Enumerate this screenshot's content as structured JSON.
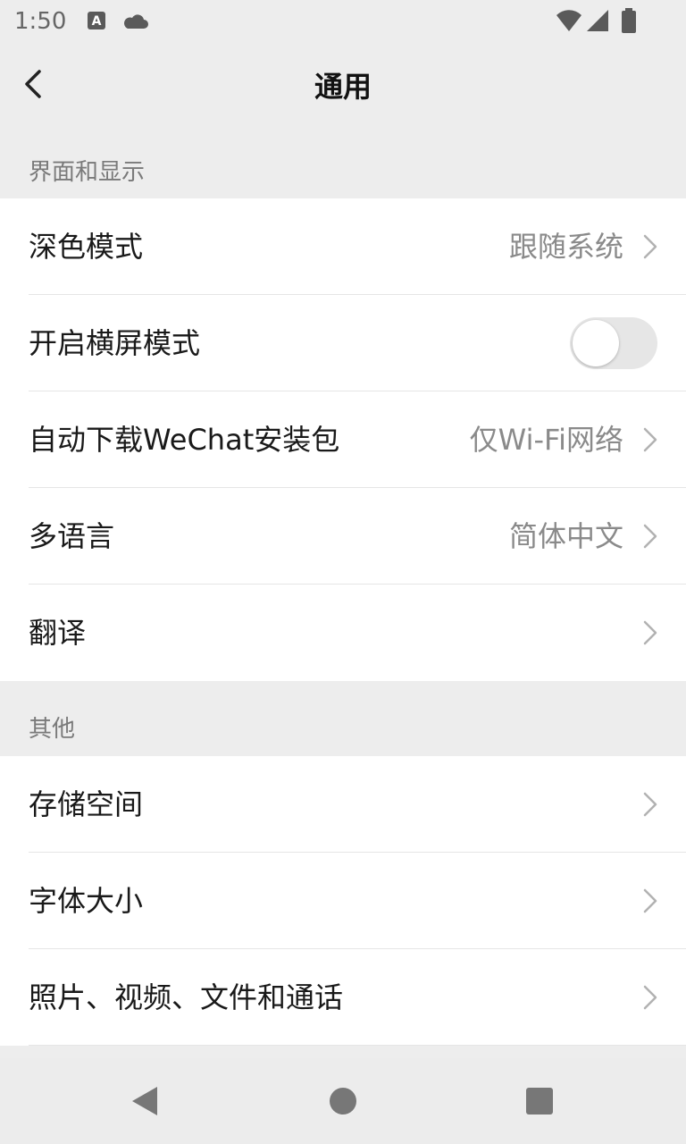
{
  "status_bar": {
    "time": "1:50",
    "icons": [
      "a-notification-icon",
      "cloud-icon",
      "wifi-icon",
      "signal-icon",
      "battery-icon"
    ]
  },
  "header": {
    "title": "通用",
    "back_icon": "back-chevron-icon"
  },
  "sections": [
    {
      "title": "界面和显示",
      "items": [
        {
          "label": "深色模式",
          "value": "跟随系统"
        },
        {
          "label": "开启横屏模式",
          "toggle": false
        },
        {
          "label": "自动下载WeChat安装包",
          "value": "仅Wi-Fi网络"
        },
        {
          "label": "多语言",
          "value": "简体中文"
        },
        {
          "label": "翻译",
          "value": ""
        }
      ]
    },
    {
      "title": "其他",
      "items": [
        {
          "label": "存储空间"
        },
        {
          "label": "字体大小"
        },
        {
          "label": "照片、视频、文件和通话"
        }
      ]
    }
  ],
  "system_nav": [
    "back-triangle-icon",
    "home-circle-icon",
    "recents-square-icon"
  ],
  "colors": {
    "background": "#ededed",
    "card": "#ffffff",
    "secondary_text": "#8a8a8a",
    "toggle_off": "#e6e6e6"
  }
}
